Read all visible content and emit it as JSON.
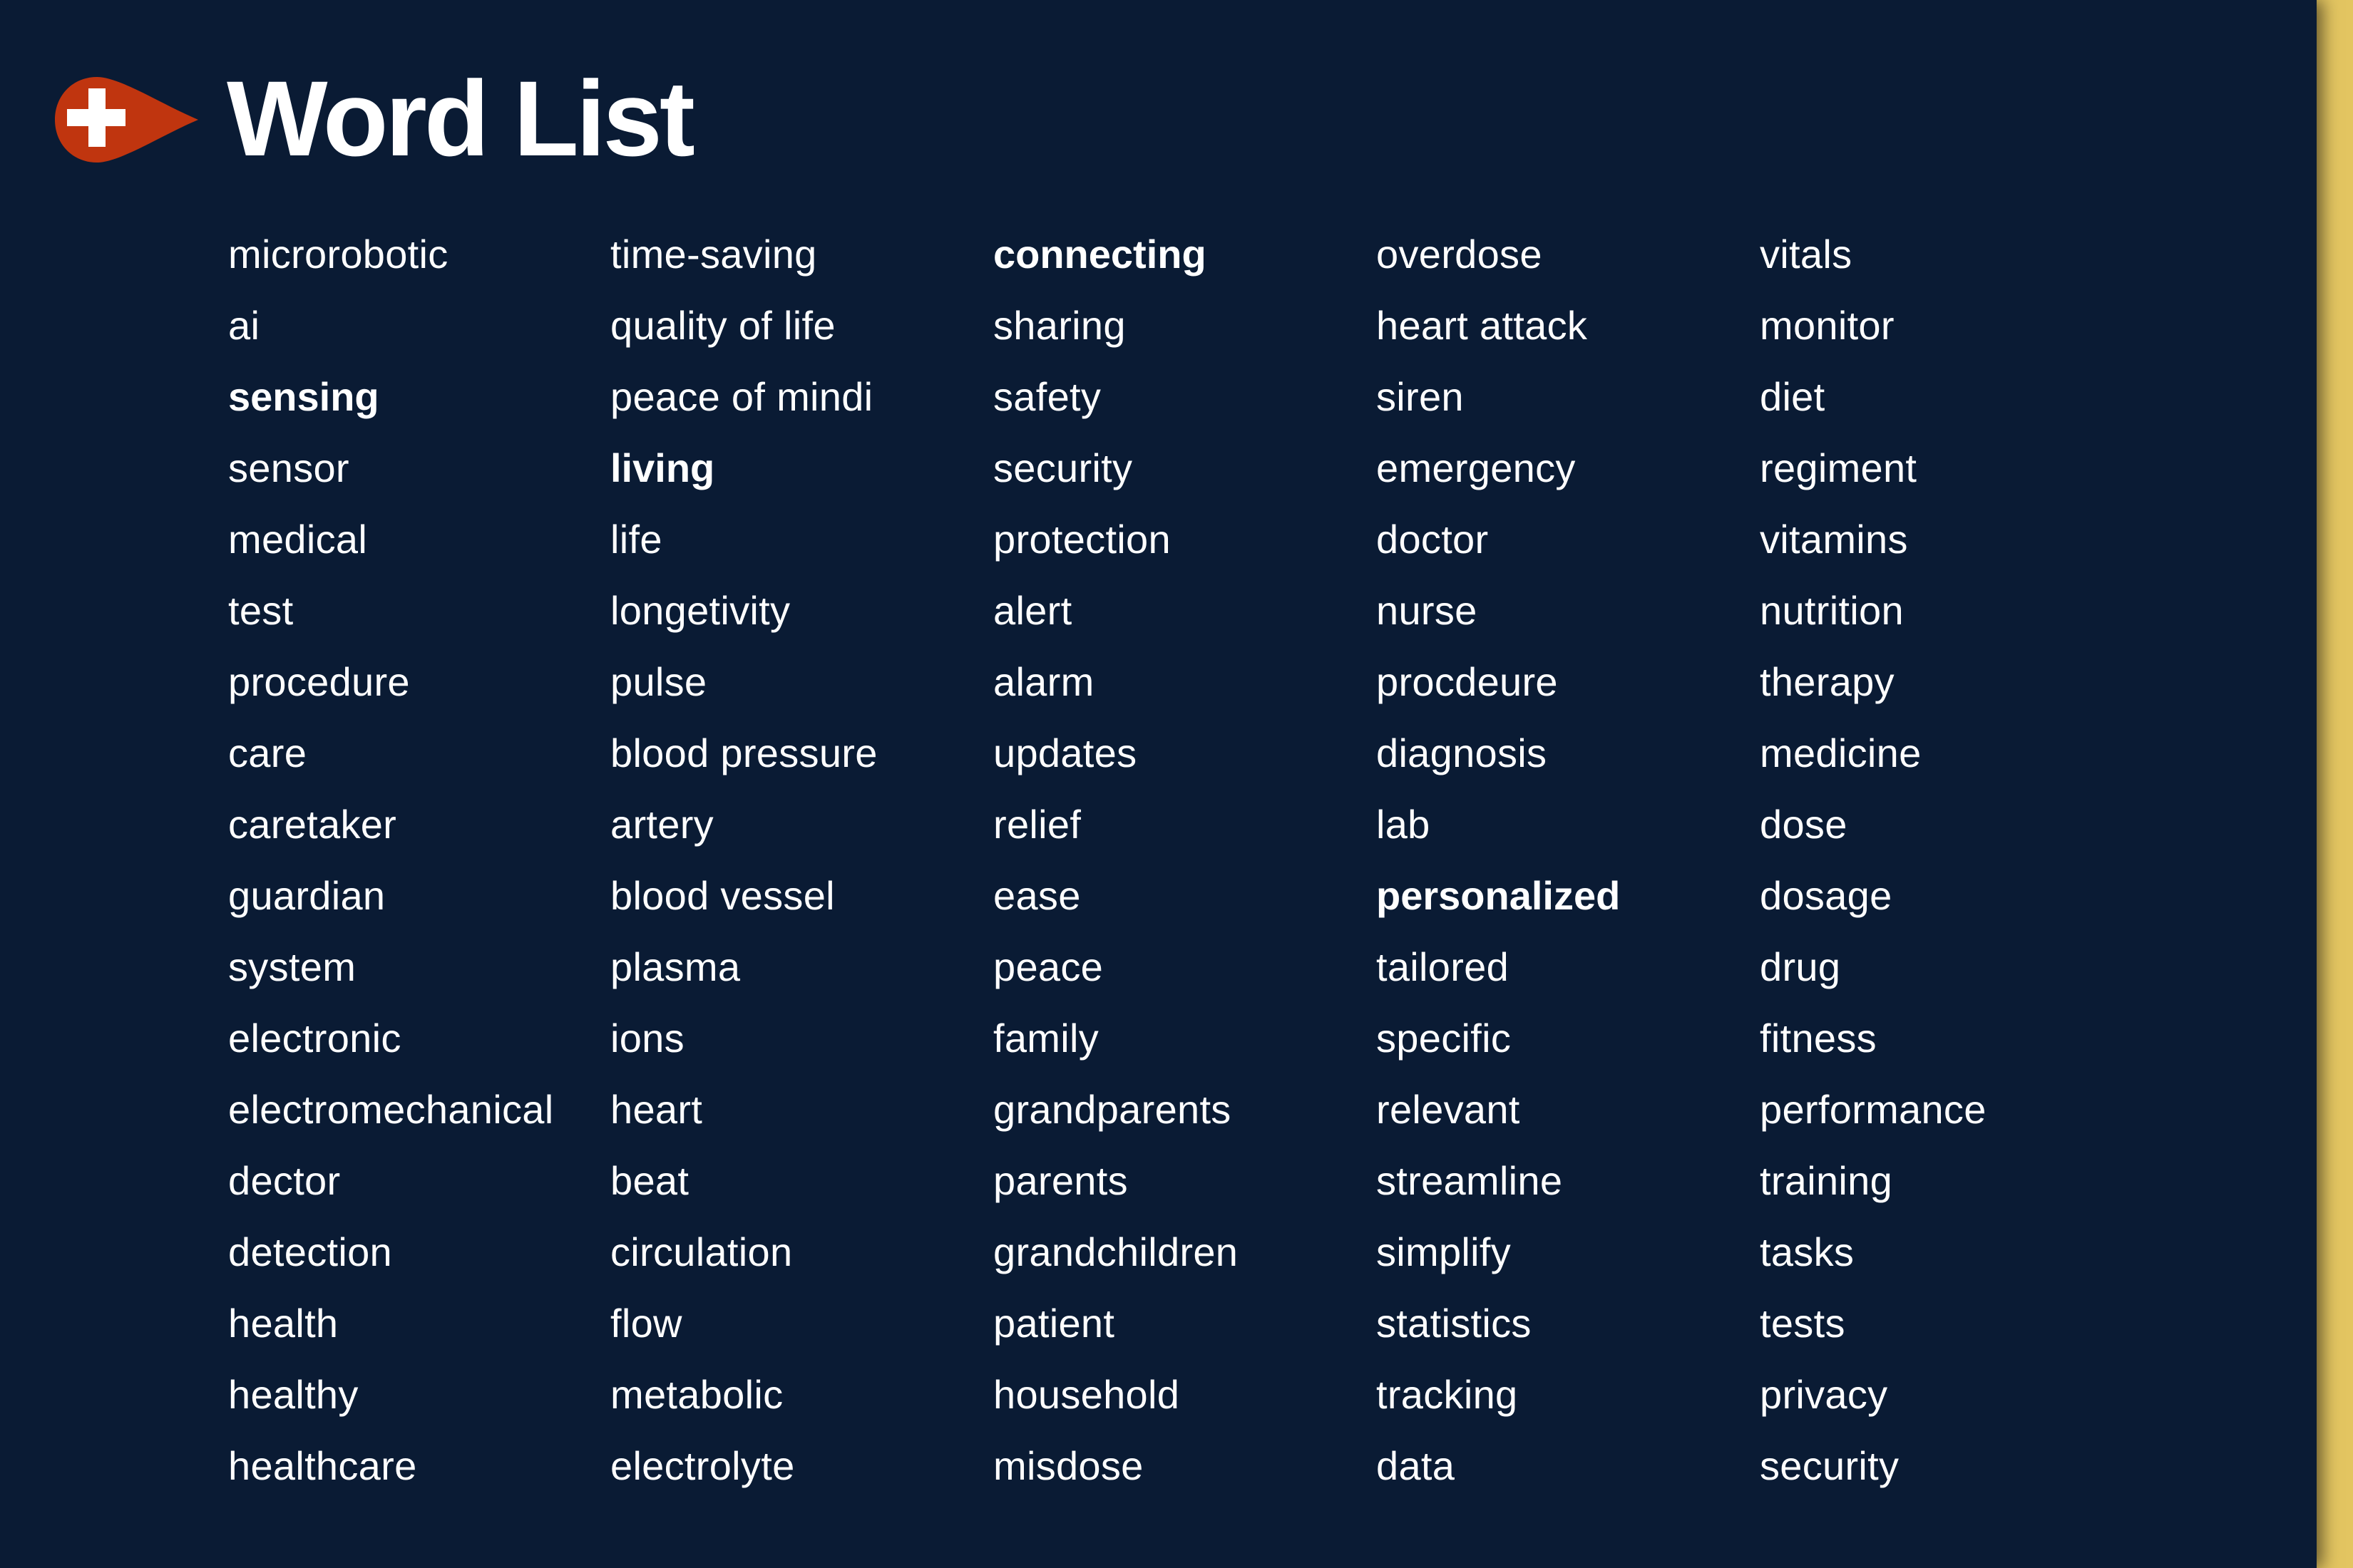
{
  "page": {
    "title": "Word List",
    "logo_icon": "medical-cross-droplet-icon",
    "colors": {
      "background": "#0A1B34",
      "accent_strip": "#E3C561",
      "logo": "#C0350F",
      "text": "#FFFFFF"
    }
  },
  "columns": [
    {
      "words": [
        {
          "text": "microrobotic",
          "bold": false
        },
        {
          "text": "ai",
          "bold": false
        },
        {
          "text": "sensing",
          "bold": true
        },
        {
          "text": "sensor",
          "bold": false
        },
        {
          "text": "medical",
          "bold": false
        },
        {
          "text": "test",
          "bold": false
        },
        {
          "text": "procedure",
          "bold": false
        },
        {
          "text": "care",
          "bold": false
        },
        {
          "text": "caretaker",
          "bold": false
        },
        {
          "text": "guardian",
          "bold": false
        },
        {
          "text": "system",
          "bold": false
        },
        {
          "text": "electronic",
          "bold": false
        },
        {
          "text": "electromechanical",
          "bold": false
        },
        {
          "text": "dector",
          "bold": false
        },
        {
          "text": "detection",
          "bold": false
        },
        {
          "text": "health",
          "bold": false
        },
        {
          "text": "healthy",
          "bold": false
        },
        {
          "text": "healthcare",
          "bold": false
        }
      ]
    },
    {
      "words": [
        {
          "text": "time-saving",
          "bold": false
        },
        {
          "text": "quality of life",
          "bold": false
        },
        {
          "text": "peace of mindi",
          "bold": false
        },
        {
          "text": "living",
          "bold": true
        },
        {
          "text": "life",
          "bold": false
        },
        {
          "text": "longetivity",
          "bold": false
        },
        {
          "text": "pulse",
          "bold": false
        },
        {
          "text": "blood pressure",
          "bold": false
        },
        {
          "text": "artery",
          "bold": false
        },
        {
          "text": "blood vessel",
          "bold": false
        },
        {
          "text": "plasma",
          "bold": false
        },
        {
          "text": "ions",
          "bold": false
        },
        {
          "text": "heart",
          "bold": false
        },
        {
          "text": "beat",
          "bold": false
        },
        {
          "text": "circulation",
          "bold": false
        },
        {
          "text": "flow",
          "bold": false
        },
        {
          "text": "metabolic",
          "bold": false
        },
        {
          "text": "electrolyte",
          "bold": false
        }
      ]
    },
    {
      "words": [
        {
          "text": "connecting",
          "bold": true
        },
        {
          "text": "sharing",
          "bold": false
        },
        {
          "text": "safety",
          "bold": false
        },
        {
          "text": "security",
          "bold": false
        },
        {
          "text": "protection",
          "bold": false
        },
        {
          "text": "alert",
          "bold": false
        },
        {
          "text": "alarm",
          "bold": false
        },
        {
          "text": "updates",
          "bold": false
        },
        {
          "text": "relief",
          "bold": false
        },
        {
          "text": "ease",
          "bold": false
        },
        {
          "text": "peace",
          "bold": false
        },
        {
          "text": "family",
          "bold": false
        },
        {
          "text": "grandparents",
          "bold": false
        },
        {
          "text": "parents",
          "bold": false
        },
        {
          "text": "grandchildren",
          "bold": false
        },
        {
          "text": "patient",
          "bold": false
        },
        {
          "text": "household",
          "bold": false
        },
        {
          "text": "misdose",
          "bold": false
        }
      ]
    },
    {
      "words": [
        {
          "text": "overdose",
          "bold": false
        },
        {
          "text": "heart attack",
          "bold": false
        },
        {
          "text": "siren",
          "bold": false
        },
        {
          "text": "emergency",
          "bold": false
        },
        {
          "text": "doctor",
          "bold": false
        },
        {
          "text": "nurse",
          "bold": false
        },
        {
          "text": "procdeure",
          "bold": false
        },
        {
          "text": "diagnosis",
          "bold": false
        },
        {
          "text": "lab",
          "bold": false
        },
        {
          "text": "personalized",
          "bold": true
        },
        {
          "text": "tailored",
          "bold": false
        },
        {
          "text": "specific",
          "bold": false
        },
        {
          "text": "relevant",
          "bold": false
        },
        {
          "text": "streamline",
          "bold": false
        },
        {
          "text": "simplify",
          "bold": false
        },
        {
          "text": "statistics",
          "bold": false
        },
        {
          "text": "tracking",
          "bold": false
        },
        {
          "text": "data",
          "bold": false
        }
      ]
    },
    {
      "words": [
        {
          "text": "vitals",
          "bold": false
        },
        {
          "text": "monitor",
          "bold": false
        },
        {
          "text": "diet",
          "bold": false
        },
        {
          "text": "regiment",
          "bold": false
        },
        {
          "text": "vitamins",
          "bold": false
        },
        {
          "text": "nutrition",
          "bold": false
        },
        {
          "text": "therapy",
          "bold": false
        },
        {
          "text": "medicine",
          "bold": false
        },
        {
          "text": "dose",
          "bold": false
        },
        {
          "text": "dosage",
          "bold": false
        },
        {
          "text": "drug",
          "bold": false
        },
        {
          "text": "fitness",
          "bold": false
        },
        {
          "text": "performance",
          "bold": false
        },
        {
          "text": "training",
          "bold": false
        },
        {
          "text": "tasks",
          "bold": false
        },
        {
          "text": "tests",
          "bold": false
        },
        {
          "text": "privacy",
          "bold": false
        },
        {
          "text": "security",
          "bold": false
        }
      ]
    }
  ]
}
